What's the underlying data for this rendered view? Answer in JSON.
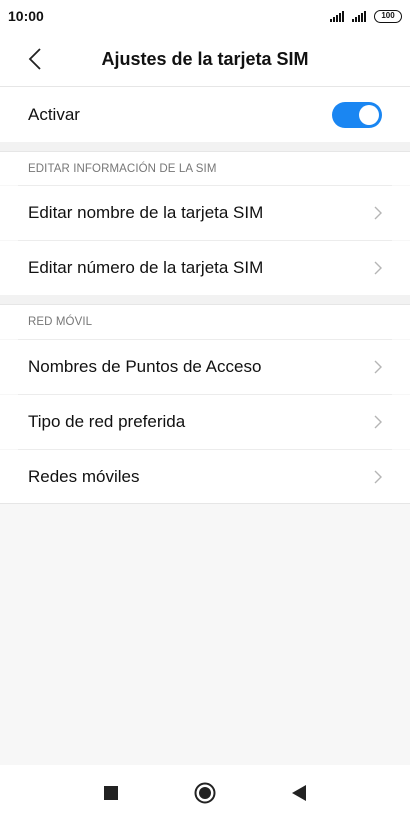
{
  "status_bar": {
    "time": "10:00",
    "battery": "100"
  },
  "header": {
    "title": "Ajustes de la tarjeta SIM",
    "back_icon": "chevron-left-icon"
  },
  "activate": {
    "label": "Activar",
    "enabled": true,
    "accent_color": "#1a86f2"
  },
  "section_sim": {
    "header": "EDITAR INFORMACIÓN DE LA SIM",
    "items": [
      {
        "label": "Editar nombre de la tarjeta SIM"
      },
      {
        "label": "Editar número de la tarjeta SIM"
      }
    ]
  },
  "section_network": {
    "header": "RED MÓVIL",
    "items": [
      {
        "label": "Nombres de Puntos de Acceso"
      },
      {
        "label": "Tipo de red preferida"
      },
      {
        "label": "Redes móviles"
      }
    ]
  },
  "nav_bar": {
    "icons": [
      "recents-square-icon",
      "home-circle-icon",
      "back-triangle-icon"
    ]
  }
}
